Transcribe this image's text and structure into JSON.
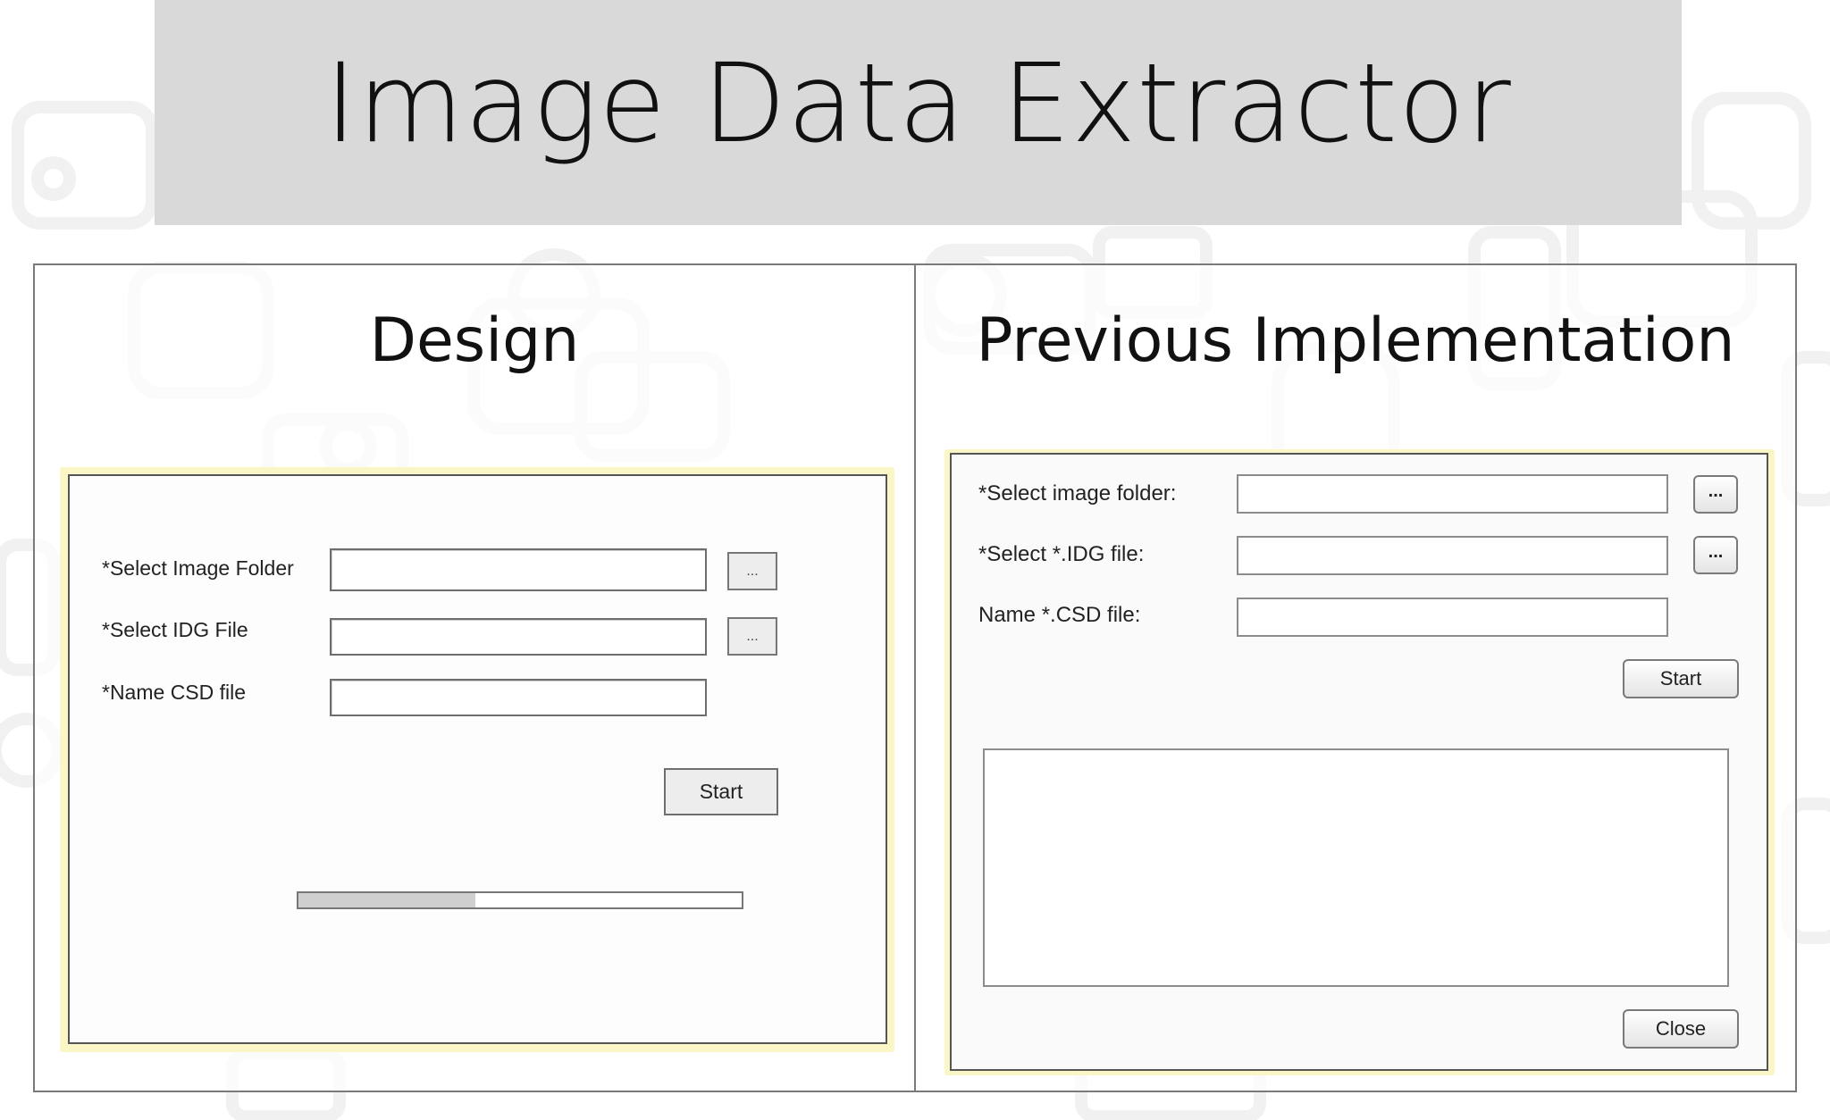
{
  "title": "Image Data Extractor",
  "design_panel": {
    "heading": "Design",
    "select_image_folder_label": "*Select Image Folder",
    "select_idg_file_label": "*Select IDG File",
    "name_csd_file_label": "*Name CSD file",
    "browse_button_label": "...",
    "start_button_label": "Start",
    "progress_fraction": 0.4
  },
  "implementation_panel": {
    "heading": "Previous Implementation",
    "select_image_folder_label": "*Select image folder:",
    "select_idg_file_label": "*Select *.IDG file:",
    "name_csd_file_label": "Name *.CSD file:",
    "browse_button_label": "...",
    "start_button_label": "Start",
    "close_button_label": "Close"
  },
  "colors": {
    "banner": "#d9d9d9",
    "window_highlight": "#fbf6c6",
    "panel_border": "#7a7a7a"
  }
}
